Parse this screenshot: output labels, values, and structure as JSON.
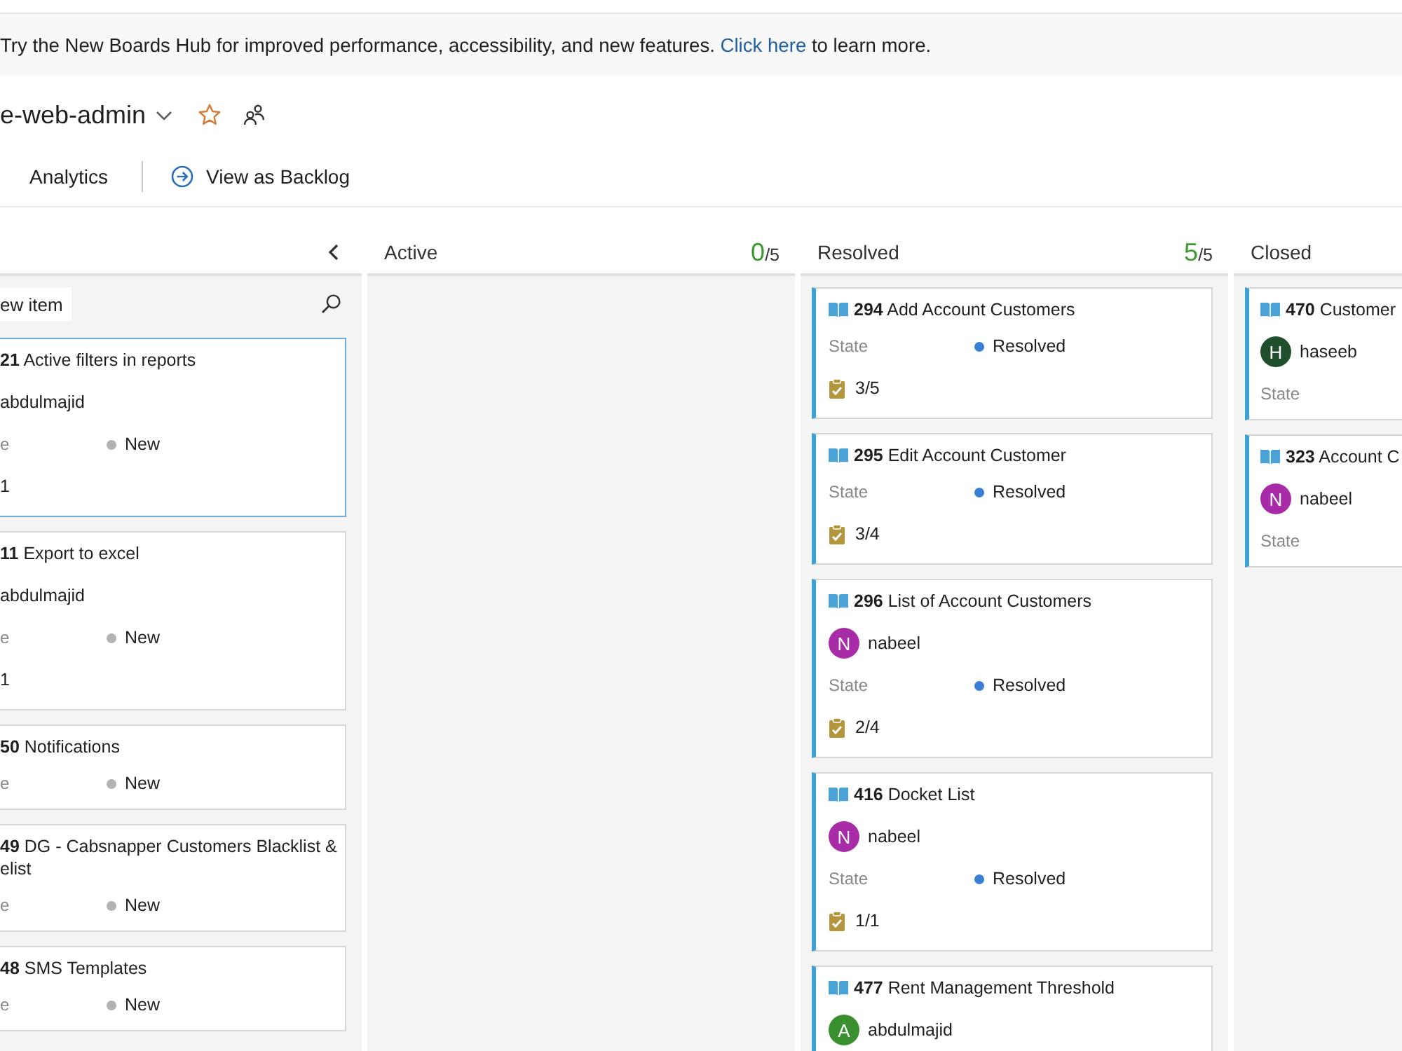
{
  "banner": {
    "text": "Try the New Boards Hub for improved performance, accessibility, and new features.",
    "link": "Click here",
    "text_after": "to learn more."
  },
  "header": {
    "title": "e-web-admin",
    "favorited": false
  },
  "tabs": [
    {
      "label": "Analytics",
      "selected": false
    }
  ],
  "view_link": {
    "label": "View as Backlog"
  },
  "columns": [
    {
      "collapsible": true,
      "new_item": "ew item",
      "cards": [
        {
          "id": "21",
          "title": "Active filters in reports",
          "selected": true,
          "assignee": {
            "name": "abdulmajid"
          },
          "state": {
            "label": "e",
            "value": "New",
            "color": "#b2b2b2"
          },
          "tasks": {
            "count": "1"
          }
        },
        {
          "id": "11",
          "title": "Export to excel",
          "selected": false,
          "assignee": {
            "name": "abdulmajid"
          },
          "state": {
            "label": "e",
            "value": "New",
            "color": "#b2b2b2"
          },
          "tasks": {
            "count": "1"
          }
        },
        {
          "id": "50",
          "title": "Notifications",
          "selected": false,
          "state": {
            "label": "e",
            "value": "New",
            "color": "#b2b2b2"
          }
        },
        {
          "id": "49",
          "title": "DG - Cabsnapper Customers Blacklist &\nelist",
          "selected": false,
          "state": {
            "label": "e",
            "value": "New",
            "color": "#b2b2b2"
          }
        },
        {
          "id": "48",
          "title": "SMS Templates",
          "selected": false,
          "state": {
            "label": "e",
            "value": "New",
            "color": "#b2b2b2"
          }
        }
      ]
    },
    {
      "title": "Active",
      "count": "0",
      "limit": "/5"
    },
    {
      "title": "Resolved",
      "count": "5",
      "limit": "/5",
      "cards": [
        {
          "type_icon": true,
          "id": "294",
          "title": "Add Account Customers",
          "selected": false,
          "state": {
            "label": "State",
            "value": "Resolved",
            "color": "#3a7fd5"
          },
          "tasks": {
            "icon": true,
            "count": "3/5"
          }
        },
        {
          "type_icon": true,
          "id": "295",
          "title": "Edit Account Customer",
          "selected": false,
          "state": {
            "label": "State",
            "value": "Resolved",
            "color": "#3a7fd5"
          },
          "tasks": {
            "icon": true,
            "count": "3/4"
          }
        },
        {
          "type_icon": true,
          "id": "296",
          "title": "List of Account Customers",
          "selected": false,
          "assignee": {
            "initial": "N",
            "name": "nabeel",
            "color": "#a82ba8"
          },
          "state": {
            "label": "State",
            "value": "Resolved",
            "color": "#3a7fd5"
          },
          "tasks": {
            "icon": true,
            "count": "2/4"
          }
        },
        {
          "type_icon": true,
          "id": "416",
          "title": "Docket List",
          "selected": false,
          "assignee": {
            "initial": "N",
            "name": "nabeel",
            "color": "#a82ba8"
          },
          "state": {
            "label": "State",
            "value": "Resolved",
            "color": "#3a7fd5"
          },
          "tasks": {
            "icon": true,
            "count": "1/1"
          }
        },
        {
          "type_icon": true,
          "id": "477",
          "title": "Rent Management Threshold",
          "selected": false,
          "assignee": {
            "initial": "A",
            "name": "abdulmajid",
            "color": "#3a8f2e"
          }
        }
      ]
    },
    {
      "title": "Closed",
      "cards": [
        {
          "type_icon": true,
          "id": "470",
          "title": "Customer",
          "selected": false,
          "assignee": {
            "initial": "H",
            "name": "haseeb",
            "color": "#1f4f2c"
          },
          "state": {
            "label": "State"
          }
        },
        {
          "type_icon": true,
          "id": "323",
          "title": "Account C",
          "selected": false,
          "assignee": {
            "initial": "N",
            "name": "nabeel",
            "color": "#a82ba8"
          },
          "state": {
            "label": "State"
          }
        }
      ]
    }
  ]
}
